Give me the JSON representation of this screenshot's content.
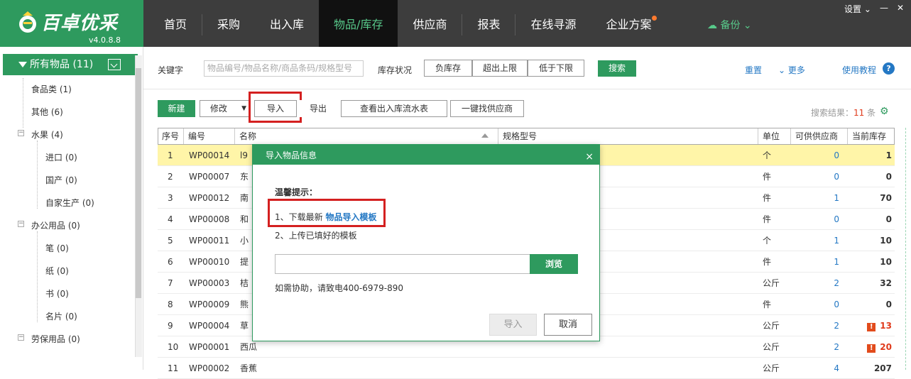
{
  "app": {
    "name": "百卓优采",
    "version": "v4.0.8.8",
    "brand_color": "#2e9a5e",
    "nav": [
      "首页",
      "采购",
      "出入库",
      "物品/库存",
      "供应商",
      "报表",
      "在线寻源",
      "企业方案"
    ],
    "active_nav": "物品/库存",
    "backup_label": "备份",
    "settings_label": "设置"
  },
  "sidebar": {
    "root_label": "所有物品 (11)",
    "items": [
      {
        "label": "食品类 (1)"
      },
      {
        "label": "其他 (6)"
      },
      {
        "label": "水果 (4)"
      },
      {
        "label": "进口 (0)"
      },
      {
        "label": "国产 (0)"
      },
      {
        "label": "自家生产 (0)"
      },
      {
        "label": "办公用品 (0)"
      },
      {
        "label": "笔 (0)"
      },
      {
        "label": "纸 (0)"
      },
      {
        "label": "书 (0)"
      },
      {
        "label": "名片 (0)"
      },
      {
        "label": "劳保用品 (0)"
      }
    ]
  },
  "filter": {
    "keyword_label": "关键字",
    "keyword_placeholder": "物品编号/物品名称/商品条码/规格型号",
    "stock_status_label": "库存状况",
    "stock_options": [
      "负库存",
      "超出上限",
      "低于下限"
    ],
    "search_button": "搜索",
    "reset_link": "重置",
    "more_link": "更多",
    "tutorial_link": "使用教程"
  },
  "toolbar": {
    "new": "新建",
    "edit": "修改",
    "import": "导入",
    "export": "导出",
    "flow": "查看出入库流水表",
    "find_supplier": "一键找供应商",
    "result_prefix": "搜索结果：",
    "result_count": "11",
    "result_suffix": " 条"
  },
  "table": {
    "headers": [
      "序号",
      "编号",
      "名称",
      "规格型号",
      "单位",
      "可供供应商",
      "当前库存"
    ],
    "rows": [
      {
        "no": "1",
        "code": "WP00014",
        "name": "l9",
        "unit": "个",
        "suppliers": "0",
        "stock": "1",
        "warn": false
      },
      {
        "no": "2",
        "code": "WP00007",
        "name": "东",
        "unit": "件",
        "suppliers": "0",
        "stock": "0",
        "warn": false
      },
      {
        "no": "3",
        "code": "WP00012",
        "name": "南",
        "unit": "件",
        "suppliers": "1",
        "stock": "70",
        "warn": false
      },
      {
        "no": "4",
        "code": "WP00008",
        "name": "和",
        "unit": "件",
        "suppliers": "0",
        "stock": "0",
        "warn": false
      },
      {
        "no": "5",
        "code": "WP00011",
        "name": "小",
        "unit": "个",
        "suppliers": "1",
        "stock": "10",
        "warn": false
      },
      {
        "no": "6",
        "code": "WP00010",
        "name": "提",
        "unit": "件",
        "suppliers": "1",
        "stock": "10",
        "warn": false
      },
      {
        "no": "7",
        "code": "WP00003",
        "name": "桔",
        "unit": "公斤",
        "suppliers": "2",
        "stock": "32",
        "warn": false
      },
      {
        "no": "8",
        "code": "WP00009",
        "name": "熊",
        "unit": "件",
        "suppliers": "0",
        "stock": "0",
        "warn": false
      },
      {
        "no": "9",
        "code": "WP00004",
        "name": "草",
        "unit": "公斤",
        "suppliers": "2",
        "stock": "13",
        "warn": true
      },
      {
        "no": "10",
        "code": "WP00001",
        "name": "西瓜",
        "unit": "公斤",
        "suppliers": "2",
        "stock": "20",
        "warn": true
      },
      {
        "no": "11",
        "code": "WP00002",
        "name": "香蕉",
        "unit": "公斤",
        "suppliers": "4",
        "stock": "207",
        "warn": false
      }
    ]
  },
  "dialog": {
    "title": "导入物品信息",
    "tip_title": "温馨提示：",
    "step1_prefix": "1、下载最新 ",
    "step1_link": "物品导入模板",
    "step2": "2、上传已填好的模板",
    "browse": "浏览",
    "help": "如需协助，请致电400-6979-890",
    "import": "导入",
    "cancel": "取消"
  }
}
